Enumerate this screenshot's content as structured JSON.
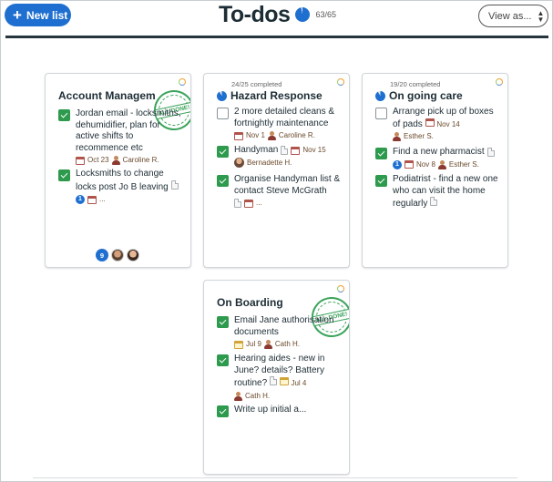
{
  "header": {
    "new_list_label": "New list",
    "title": "To-dos",
    "progress_text": "63/65",
    "view_as_label": "View as..."
  },
  "cards": {
    "account": {
      "title": "Account Managem",
      "stamp": "ALL DONE!",
      "items": [
        {
          "text": "Jordan email - locksmiths, dehumidifier, plan for active shifts to recommence etc",
          "date": "Oct 23",
          "assignee": "Caroline R."
        },
        {
          "text": "Locksmiths to change locks post Jo B leaving",
          "badge": "1",
          "more": "..."
        }
      ],
      "footer_count": "9"
    },
    "hazard": {
      "sub": "24/25 completed",
      "title": "Hazard Response",
      "items": [
        {
          "text": "2 more detailed cleans & fortnightly maintenance",
          "date": "Nov 1",
          "assignee": "Caroline R."
        },
        {
          "text": "Handyman",
          "date": "Nov 15",
          "assignee": "Bernadette H."
        },
        {
          "text": "Organise Handyman list & contact Steve McGrath",
          "more": "..."
        }
      ]
    },
    "ongoing": {
      "sub": "19/20 completed",
      "title": "On going care",
      "items": [
        {
          "text": "Arrange pick up of boxes of pads",
          "date": "Nov 14",
          "assignee": "Esther S."
        },
        {
          "text": "Find a new pharmacist",
          "badge": "1",
          "date": "Nov 8",
          "assignee": "Esther S."
        },
        {
          "text": "Podiatrist - find a new one who can visit the home regularly"
        }
      ]
    },
    "onboarding": {
      "title": "On Boarding",
      "stamp": "ALL DONE!",
      "items": [
        {
          "text": "Email Jane authorisation documents",
          "date": "Jul 9",
          "assignee": "Cath H."
        },
        {
          "text": "Hearing aides - new in June? details? Battery routine?",
          "date": "Jul 4",
          "assignee": "Cath H."
        },
        {
          "text": "Write up initial a..."
        }
      ]
    }
  }
}
